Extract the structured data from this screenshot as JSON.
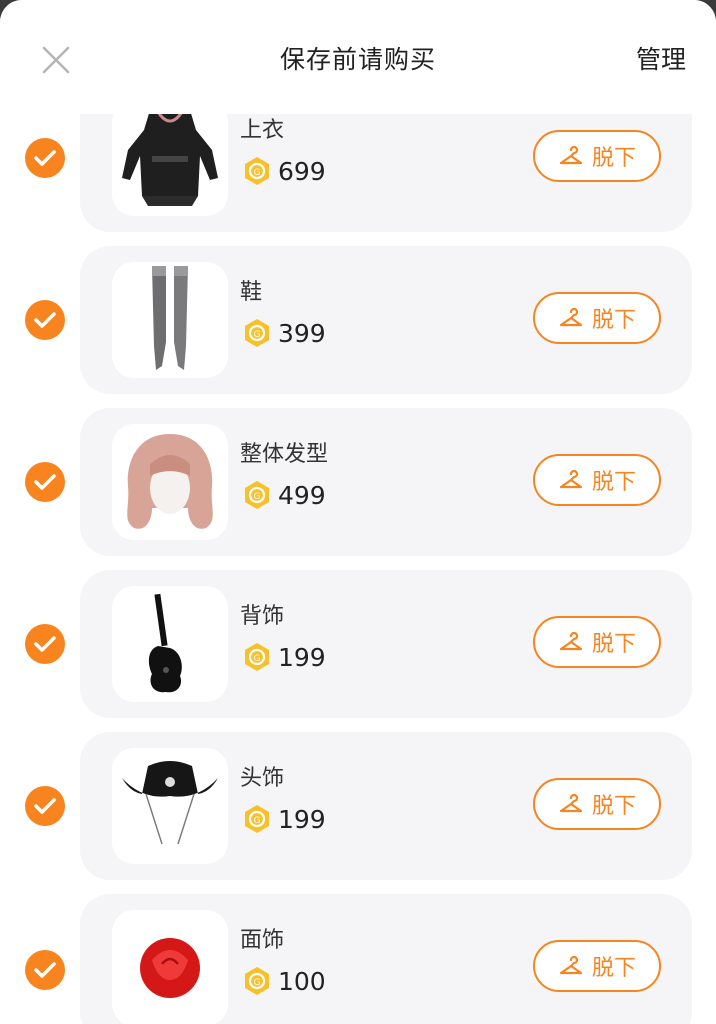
{
  "header": {
    "title": "保存前请购买",
    "manage_label": "管理"
  },
  "items": [
    {
      "name": "上衣",
      "price": "699",
      "button": "脱下"
    },
    {
      "name": "鞋",
      "price": "399",
      "button": "脱下"
    },
    {
      "name": "整体发型",
      "price": "499",
      "button": "脱下"
    },
    {
      "name": "背饰",
      "price": "199",
      "button": "脱下"
    },
    {
      "name": "头饰",
      "price": "199",
      "button": "脱下"
    },
    {
      "name": "面饰",
      "price": "100",
      "button": "脱下"
    }
  ],
  "colors": {
    "accent": "#f7841f",
    "coin": "#f6c12a",
    "card_bg": "#f5f5f8"
  },
  "icons": {
    "close": "close-icon",
    "check": "check-icon",
    "hanger": "hanger-icon",
    "coin": "coin-icon"
  }
}
